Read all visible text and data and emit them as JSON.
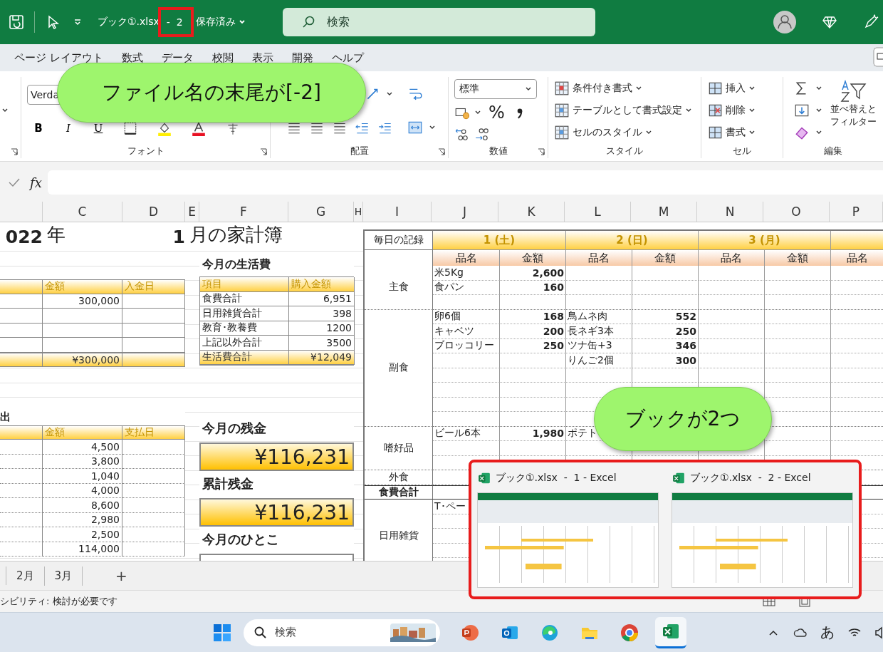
{
  "title_bar": {
    "file_name": "ブック①.xlsx",
    "window_suffix": "-  2",
    "save_status": "保存済み",
    "search_placeholder": "検索"
  },
  "ribbon_tabs": [
    "ページ レイアウト",
    "数式",
    "データ",
    "校閲",
    "表示",
    "開発",
    "ヘルプ"
  ],
  "ribbon": {
    "font": {
      "font_name": "Verda",
      "buttons": [
        "B",
        "I",
        "U"
      ],
      "label": "フォント"
    },
    "alignment": {
      "label": "配置"
    },
    "number": {
      "format": "標準",
      "percent": "%",
      "label": "数値"
    },
    "styles": {
      "items": [
        "条件付き書式",
        "テーブルとして書式設定",
        "セルのスタイル"
      ],
      "label": "スタイル"
    },
    "cells": {
      "items": [
        "挿入",
        "削除",
        "書式"
      ],
      "label": "セル"
    },
    "editing": {
      "sort_filter": [
        "並べ替えと",
        "フィルター"
      ],
      "label": "編集"
    }
  },
  "formula_bar": {
    "fx": "fx"
  },
  "column_headers": [
    "C",
    "D",
    "E",
    "F",
    "G",
    "H",
    "I",
    "J",
    "K",
    "L",
    "M",
    "N",
    "O",
    "P"
  ],
  "sheet": {
    "title": {
      "year": "022",
      "year_unit": "年",
      "month": "1",
      "month_title": "月の家計簿"
    },
    "income": {
      "headers": [
        "金額",
        "入金日"
      ],
      "rows": [
        {
          "amount": "300,000"
        },
        {},
        {},
        {}
      ],
      "total": "¥300,000"
    },
    "expenses": {
      "heading": "出",
      "headers": [
        "金額",
        "支払日"
      ],
      "rows": [
        {
          "amount": "4,500"
        },
        {
          "amount": "3,800"
        },
        {
          "amount": "1,040"
        },
        {
          "amount": "4,000"
        },
        {
          "amount": "8,600"
        },
        {
          "amount": "2,980"
        },
        {
          "amount": "2,500"
        },
        {
          "amount": "114,000"
        }
      ]
    },
    "living_costs": {
      "heading": "今月の生活費",
      "headers": [
        "項目",
        "購入金額"
      ],
      "rows": [
        {
          "item": "食費合計",
          "amount": "6,951"
        },
        {
          "item": "日用雑貨合計",
          "amount": "398"
        },
        {
          "item": "教育･教養費",
          "amount": "1200"
        },
        {
          "item": "上記以外合計",
          "amount": "3500"
        }
      ],
      "total": {
        "item": "生活費合計",
        "amount": "¥12,049"
      }
    },
    "balances": [
      {
        "heading": "今月の残金",
        "value": "¥116,231"
      },
      {
        "heading": "累計残金",
        "value": "¥116,231"
      }
    ],
    "comment": {
      "heading": "今月のひとこ"
    },
    "daily_record": {
      "corner": "毎日の記録",
      "days": [
        "1 (土)",
        "2 (日)",
        "3 (月)"
      ],
      "subheaders": [
        "品名",
        "金額",
        "品名",
        "金額",
        "品名",
        "金額",
        "品名"
      ],
      "categories": [
        {
          "kind": "group",
          "name": "主食",
          "rows": [
            {
              "j": "米5Kg",
              "k": "2,600"
            },
            {
              "j": "食パン",
              "k": "160"
            },
            {}
          ]
        },
        {
          "kind": "group",
          "name": "副食",
          "rows": [
            {
              "j": "卵6個",
              "k": "168",
              "l": "鳥ムネ肉",
              "m": "552"
            },
            {
              "j": "キャベツ",
              "k": "200",
              "l": "長ネギ3本",
              "m": "250"
            },
            {
              "j": "ブロッコリー",
              "k": "250",
              "l": "ツナ缶+3",
              "m": "346"
            },
            {
              "l": "りんご2個",
              "m": "300"
            },
            {},
            {},
            {},
            {}
          ]
        },
        {
          "kind": "group",
          "name": "嗜好品",
          "rows": [
            {
              "j": "ビール6本",
              "k": "1,980",
              "l": "ポテト"
            },
            {},
            {}
          ]
        },
        {
          "kind": "group",
          "name": "外食",
          "rows": [
            {}
          ]
        },
        {
          "kind": "total",
          "name": "食費合計",
          "rows": [
            {}
          ]
        },
        {
          "kind": "group",
          "name": "日用雑貨",
          "rows": [
            {
              "j": "T･ペー"
            },
            {},
            {},
            {},
            {}
          ]
        }
      ]
    }
  },
  "sheet_tabs": [
    "2月",
    "3月"
  ],
  "add_sheet": "+",
  "status_bar": {
    "text": "シビリティ: 検討が必要です"
  },
  "window_previews": [
    {
      "title": "ブック①.xlsx  -  1 - Excel"
    },
    {
      "title": "ブック①.xlsx  -  2 - Excel"
    }
  ],
  "callouts": [
    "ファイル名の末尾が[-2]",
    "ブックが2つ"
  ],
  "taskbar": {
    "search_placeholder": "検索",
    "ime": "あ"
  }
}
